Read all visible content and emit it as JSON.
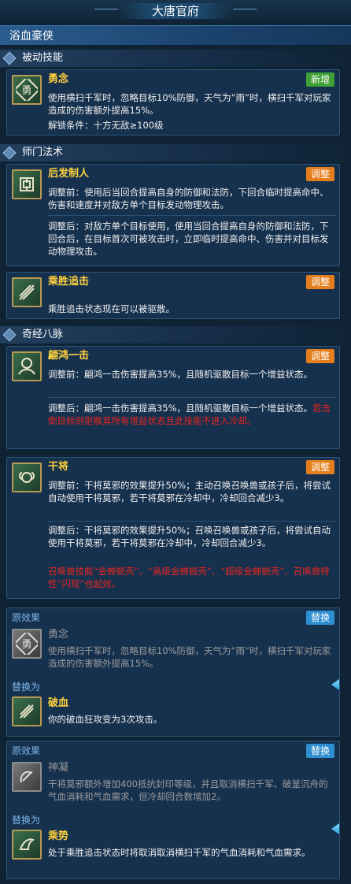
{
  "header": {
    "title": "大唐官府"
  },
  "subheader": {
    "title": "浴血豪侠"
  },
  "sections": {
    "passive": "被动技能",
    "school": "师门法术",
    "meridian": "奇经八脉"
  },
  "cards": {
    "yongnian": {
      "name": "勇念",
      "badge": "新增",
      "text": "使用横扫千军时，忽略目标10%防御，天气为“雨”时，横扫千军对玩家造成的伤害额外提高15%。",
      "unlock": "解锁条件：十方无敌≥100级"
    },
    "houfazhiren": {
      "name": "后发制人",
      "badge": "调整",
      "before": "调整前：使用后当回合提高自身的防御和法防，下回合临时提高命中、伤害和速度并对敌方单个目标发动物理攻击。",
      "after": "调整后：对敌方单个目标使用，使用当回合提高自身的防御和法防，下回合后，在目标首次可被攻击时，立即临时提高命中、伤害并对目标发动物理攻击。"
    },
    "chengshengzhuiji": {
      "name": "乘胜追击",
      "badge": "调整",
      "text": "乘胜追击状态现在可以被驱散。"
    },
    "fanhongyiji": {
      "name": "翩鸿一击",
      "badge": "调整",
      "before": "调整前：翩鸿一击伤害提高35%，且随机驱散目标一个增益状态。",
      "after": "调整后：翩鸿一击伤害提高35%，且随机驱散目标一个增益状态。",
      "after_red": "若击倒目标则驱散其所有增益状态且此技能不进入冷却。"
    },
    "ganjiang": {
      "name": "干将",
      "badge": "调整",
      "before": "调整前：干将莫邪的效果提升50%；主动召唤召唤兽或孩子后，将尝试自动使用干将莫邪，若干将莫邪在冷却中，冷却回合减少3。",
      "after": "调整后：干将莫邪的效果提升50%；召唤召唤兽或孩子后，将尝试自动使用干将莫邪，若干将莫邪在冷却中，冷却回合减少3。",
      "red": "召唤兽技能“金蝉蜕壳”、“高级金蝉蜕壳”、“超级金蝉蜕壳”、召唤兽特性“闪现”也起效。"
    },
    "replace1": {
      "orig_label": "原效果",
      "badge": "替换",
      "orig_name": "勇念",
      "orig_text": "使用横扫千军时，忽略目标10%防御，天气为“雨”时，横扫千军对玩家造成的伤害额外提高15%。",
      "new_label": "替换为",
      "new_name": "破血",
      "new_text": "你的破血狂攻变为3次攻击。"
    },
    "replace2": {
      "orig_label": "原效果",
      "badge": "替换",
      "orig_name": "神凝",
      "orig_text": "干将莫邪额外增加400抵抗封印等级，并且取消横扫千军、破釜沉舟的气血消耗和气血需求，但冷却回合数增加2。",
      "new_label": "替换为",
      "new_name": "乘势",
      "new_text": "处于乘胜追击状态时将取消取消横扫千军的气血消耗和气血需求。"
    }
  },
  "icons": [
    "courage-icon",
    "counter-icon",
    "pursuit-icon",
    "swan-strike-icon",
    "ram-icon",
    "courage-gray-icon",
    "blood-break-icon",
    "focus-gray-icon",
    "momentum-icon"
  ],
  "colors": {
    "accent_yellow": "#ffd23d",
    "badge_new": "#3fa034",
    "badge_adjust": "#e47e1c",
    "badge_replace": "#2f8fd0",
    "highlight_red": "#e8251f",
    "label_blue": "#7fb7ea"
  }
}
